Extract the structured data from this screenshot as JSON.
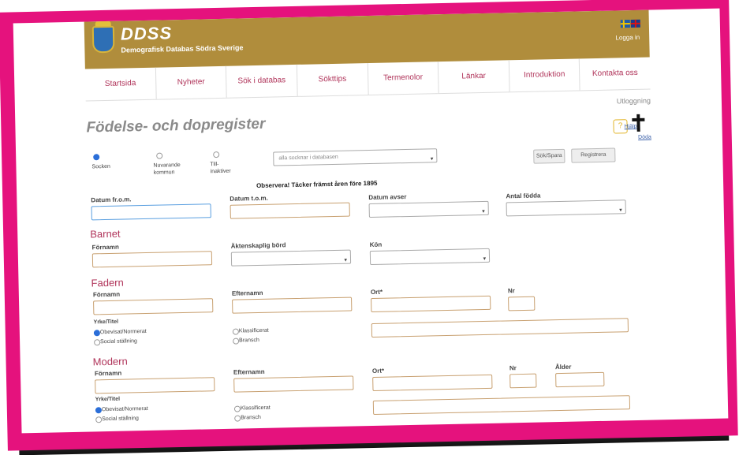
{
  "header": {
    "logo": "DDSS",
    "tagline": "Demografisk Databas Södra Sverige",
    "login": "Logga in"
  },
  "nav": [
    "Startsida",
    "Nyheter",
    "Sök i databas",
    "Sökttips",
    "Termenolor",
    "Länkar",
    "Introduktion",
    "Kontakta oss"
  ],
  "utloggning": "Utloggning",
  "page_title": "Födelse- och dopregister",
  "help_label": "Hjälp",
  "hemma_label": "Döda",
  "radios": [
    {
      "label": "Socken",
      "selected": true
    },
    {
      "label": "Nuvarande kommun",
      "selected": false
    },
    {
      "label": "Till-inaktiver",
      "selected": false
    }
  ],
  "parish_select": "alla socknar i databasen",
  "buttons": {
    "search": "Sök/Spara",
    "register": "Registrera"
  },
  "notice": "Observera! Täcker främst åren före 1895",
  "labels": {
    "datum_from": "Datum fr.o.m.",
    "datum_tom": "Datum t.o.m.",
    "datum_avser": "Datum avser",
    "antal_fodda": "Antal födda",
    "fornamn": "Förnamn",
    "aktenskaplig": "Äktenskaplig börd",
    "kon": "Kön",
    "efternamn": "Efternamn",
    "ort": "Ort*",
    "nr": "Nr",
    "alder": "Ålder",
    "yrke": "Yrke/Titel"
  },
  "sections": {
    "barnet": "Barnet",
    "fadern": "Fadern",
    "modern": "Modern"
  },
  "yrke_options": [
    {
      "label": "Obevisat/Normerat",
      "selected": true
    },
    {
      "label": "Social ställning",
      "selected": false
    },
    {
      "label": "Klassificerat",
      "selected": false
    },
    {
      "label": "Bransch",
      "selected": false
    }
  ]
}
